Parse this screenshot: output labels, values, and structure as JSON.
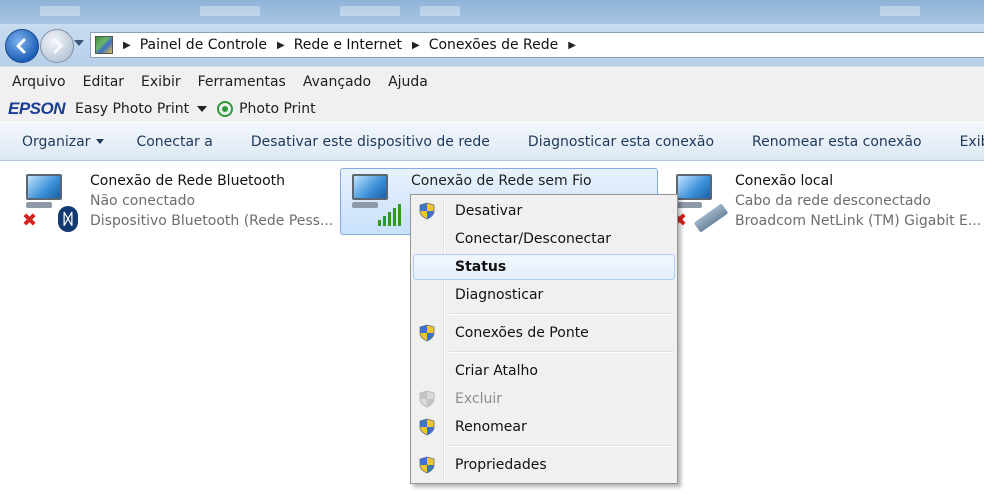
{
  "breadcrumb": [
    "Painel de Controle",
    "Rede e Internet",
    "Conexões de Rede"
  ],
  "menubar": [
    "Arquivo",
    "Editar",
    "Exibir",
    "Ferramentas",
    "Avançado",
    "Ajuda"
  ],
  "epson": {
    "logo": "EPSON",
    "easy_photo_print": "Easy Photo Print",
    "photo_print": "Photo Print"
  },
  "commandbar": {
    "organize": "Organizar",
    "items": [
      "Conectar a",
      "Desativar este dispositivo de rede",
      "Diagnosticar esta conexão",
      "Renomear esta conexão",
      "Exibir o st"
    ]
  },
  "connections": [
    {
      "name": "Conexão de Rede Bluetooth",
      "status": "Não conectado",
      "device": "Dispositivo Bluetooth (Rede Pess..."
    },
    {
      "name": "Conexão de Rede sem Fio"
    },
    {
      "name": "Conexão local",
      "status": "Cabo da rede desconectado",
      "device": "Broadcom NetLink (TM) Gigabit E..."
    }
  ],
  "context_menu": [
    {
      "label": "Desativar",
      "icon": "uac-shield-icon"
    },
    {
      "label": "Conectar/Desconectar"
    },
    {
      "label": "Status",
      "bold": true,
      "highlighted": true
    },
    {
      "label": "Diagnosticar"
    },
    {
      "label": "Conexões de Ponte",
      "icon": "uac-shield-icon"
    },
    {
      "label": "Criar Atalho"
    },
    {
      "label": "Excluir",
      "icon": "uac-shield-icon",
      "disabled": true
    },
    {
      "label": "Renomear",
      "icon": "uac-shield-icon"
    },
    {
      "label": "Propriedades",
      "icon": "uac-shield-icon"
    }
  ],
  "colors": {
    "command_text": "#1e395b",
    "selection_border": "#84acdd",
    "error_red": "#d8201c",
    "signal_green": "#2e9b1e"
  }
}
